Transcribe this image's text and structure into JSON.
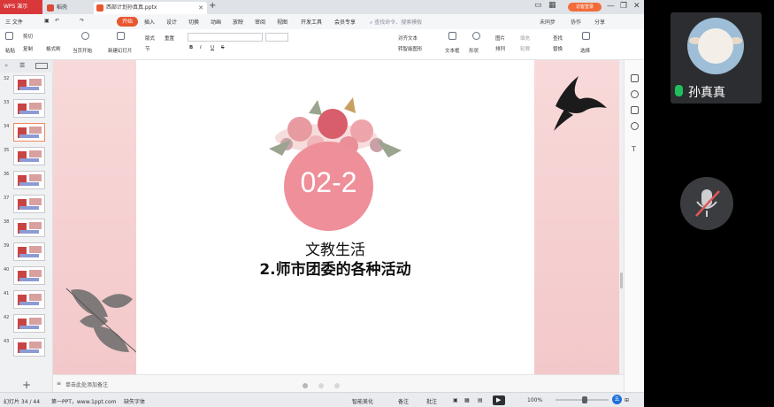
{
  "titlebar": {
    "wps_tab": "WPS 演示",
    "home_tab": "稻壳",
    "doc_tab": "西部计划孙真真.pptx",
    "login_badge": "访客登录",
    "colors": {
      "wps": "#d9383a",
      "accent": "#e8572f"
    }
  },
  "menu": {
    "file": "三 文件",
    "items": [
      "开始",
      "插入",
      "设计",
      "切换",
      "动画",
      "放映",
      "审阅",
      "视图",
      "开发工具",
      "会员专享"
    ],
    "search_placeholder": "查找命令、搜索模板",
    "right": [
      "未同步",
      "协作",
      "分享"
    ]
  },
  "ribbon": {
    "paste": "粘贴",
    "cut": "剪切",
    "copy": "复制",
    "format_painter": "格式刷",
    "from_current": "当页开始",
    "new_slide": "新建幻灯片",
    "layout": "版式",
    "section": "节",
    "reset": "重置",
    "bold": "B",
    "italic": "I",
    "underline": "U",
    "strike": "S",
    "text_box": "文本框",
    "shape": "形状",
    "arrange": "排列",
    "picture": "图片",
    "fill": "填充",
    "outline": "轮廓",
    "find": "查找",
    "replace": "替换",
    "select": "选择",
    "align_text": "对齐文本",
    "smartart": "转智能图形"
  },
  "slides": [
    {
      "num": "32"
    },
    {
      "num": "33"
    },
    {
      "num": "34"
    },
    {
      "num": "35"
    },
    {
      "num": "36"
    },
    {
      "num": "37"
    },
    {
      "num": "38"
    },
    {
      "num": "39"
    },
    {
      "num": "40"
    },
    {
      "num": "41"
    },
    {
      "num": "42"
    },
    {
      "num": "43"
    }
  ],
  "current_slide": {
    "number_label": "02-2",
    "title": "文教生活",
    "subtitle": "2.师市团委的各种活动"
  },
  "notes_placeholder": "单击此处添加备注",
  "status": {
    "slide_count": "幻灯片 34 / 44",
    "theme": "第一PPT，www.1ppt.com",
    "missing_font": "缺失字体",
    "smart_beautify": "智能美化",
    "notes": "备注",
    "comment": "批注",
    "zoom": "100%"
  },
  "video": {
    "username": "孙真真",
    "colors": {
      "mic_on": "#1fc05b",
      "mic_off": "#e05656"
    }
  }
}
